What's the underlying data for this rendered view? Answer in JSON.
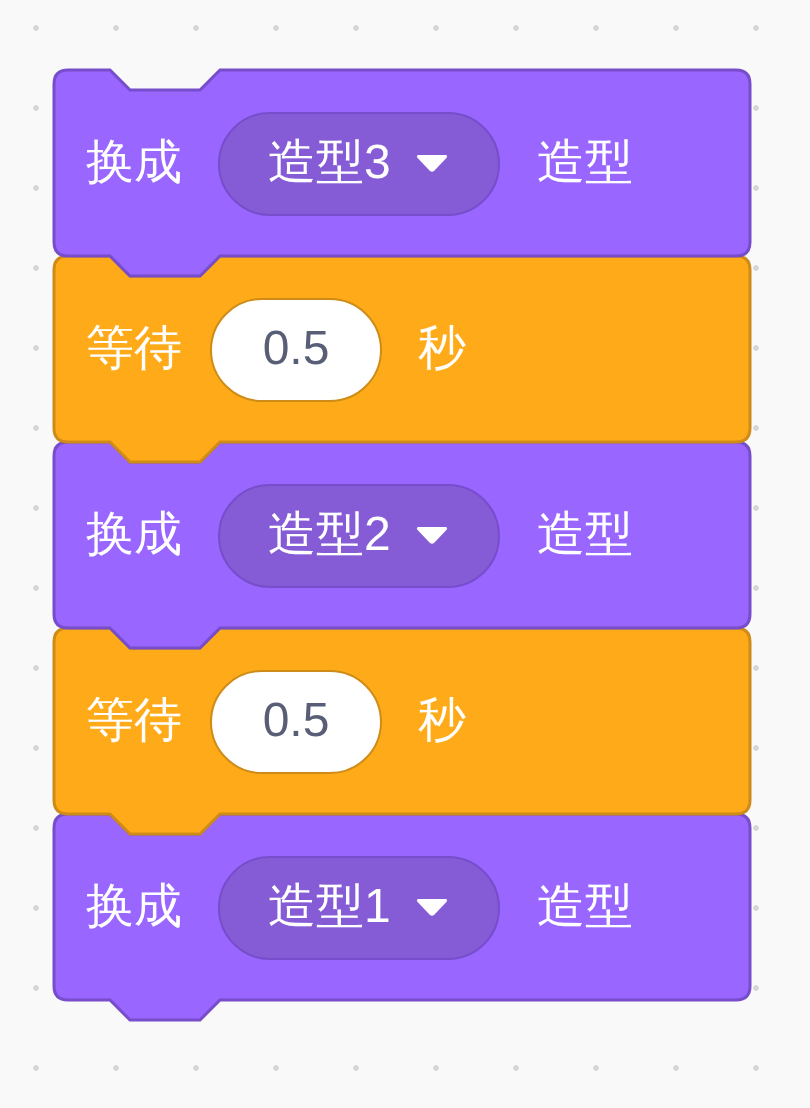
{
  "blocks": [
    {
      "kind": "switch_costume",
      "label": "换成",
      "costume": "造型3",
      "suffix": "造型"
    },
    {
      "kind": "wait",
      "label": "等待",
      "value": "0.5",
      "suffix": "秒"
    },
    {
      "kind": "switch_costume",
      "label": "换成",
      "costume": "造型2",
      "suffix": "造型"
    },
    {
      "kind": "wait",
      "label": "等待",
      "value": "0.5",
      "suffix": "秒"
    },
    {
      "kind": "switch_costume",
      "label": "换成",
      "costume": "造型1",
      "suffix": "造型"
    }
  ]
}
